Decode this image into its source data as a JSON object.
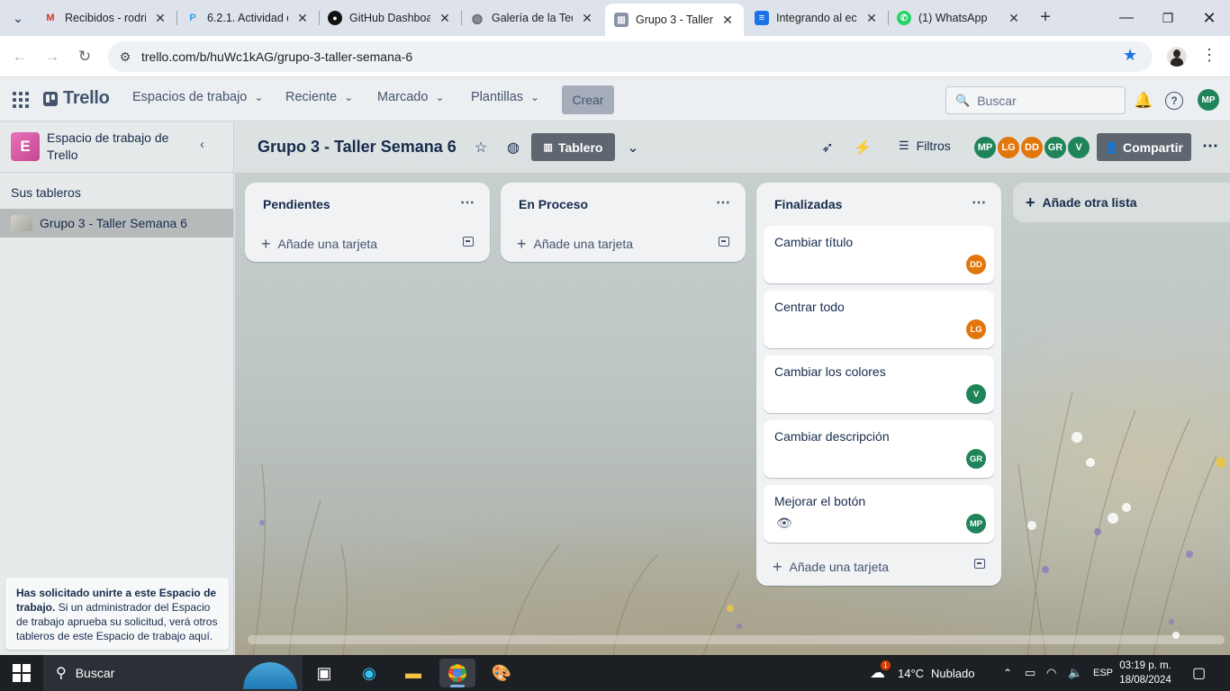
{
  "browser": {
    "tabs": [
      {
        "title": "Recibidos - rodri",
        "icon": "gmail-icon",
        "color": "#d93025",
        "glyph": "M"
      },
      {
        "title": "6.2.1. Actividad d",
        "icon": "p-icon",
        "color": "#2aa4e3",
        "glyph": "P"
      },
      {
        "title": "GitHub Dashboa",
        "icon": "github-icon",
        "color": "#111111",
        "glyph": "●"
      },
      {
        "title": "Galería de la Tec",
        "icon": "globe-icon",
        "color": "#5f6368",
        "glyph": "◍"
      },
      {
        "title": "Grupo 3 - Taller",
        "icon": "trello-tab-icon",
        "color": "#6b778c",
        "glyph": "▥"
      },
      {
        "title": "Integrando al ec",
        "icon": "docs-icon",
        "color": "#1a73e8",
        "glyph": "≡"
      },
      {
        "title": "(1) WhatsApp",
        "icon": "whatsapp-icon",
        "color": "#25d366",
        "glyph": "✆"
      }
    ],
    "active_tab": 4,
    "url": "trello.com/b/huWc1kAG/grupo-3-taller-semana-6"
  },
  "trello_header": {
    "logo": "Trello",
    "menus": [
      "Espacios de trabajo",
      "Reciente",
      "Marcado",
      "Plantillas"
    ],
    "create": "Crear",
    "search_placeholder": "Buscar",
    "user_initials": "MP",
    "user_color": "#1f845a"
  },
  "sidebar": {
    "workspace_initial": "E",
    "workspace_name": "Espacio de trabajo de Trello",
    "boards_heading": "Sus tableros",
    "boards": [
      "Grupo 3 - Taller Semana 6"
    ],
    "notice_bold": "Has solicitado unirte a este Espacio de trabajo.",
    "notice_text": "Si un administrador del Espacio de trabajo aprueba su solicitud, verá otros tableros de este Espacio de trabajo aquí."
  },
  "board": {
    "title": "Grupo 3 - Taller Semana 6",
    "view_button": "Tablero",
    "filters": "Filtros",
    "share": "Compartir",
    "members": [
      {
        "initials": "MP",
        "color": "#1f845a"
      },
      {
        "initials": "LG",
        "color": "#e2760b"
      },
      {
        "initials": "DD",
        "color": "#e2760b"
      },
      {
        "initials": "GR",
        "color": "#1f845a"
      },
      {
        "initials": "V",
        "color": "#1f845a"
      }
    ],
    "lists": [
      {
        "title": "Pendientes",
        "add_card": "Añade una tarjeta",
        "cards": []
      },
      {
        "title": "En Proceso",
        "add_card": "Añade una tarjeta",
        "cards": []
      },
      {
        "title": "Finalizadas",
        "add_card": "Añade una tarjeta",
        "cards": [
          {
            "title": "Cambiar título",
            "member": "DD",
            "color": "#e2760b"
          },
          {
            "title": "Centrar todo",
            "member": "LG",
            "color": "#e2760b"
          },
          {
            "title": "Cambiar los colores",
            "member": "V",
            "color": "#1f845a"
          },
          {
            "title": "Cambiar descripción",
            "member": "GR",
            "color": "#1f845a"
          },
          {
            "title": "Mejorar el botón",
            "member": "MP",
            "color": "#1f845a",
            "watching": true
          }
        ]
      }
    ],
    "add_list": "Añade otra lista"
  },
  "taskbar": {
    "search": "Buscar",
    "weather_temp": "14°C",
    "weather_text": "Nublado",
    "weather_badge": "1",
    "language": "ESP",
    "time": "03:19 p. m.",
    "date": "18/08/2024"
  }
}
